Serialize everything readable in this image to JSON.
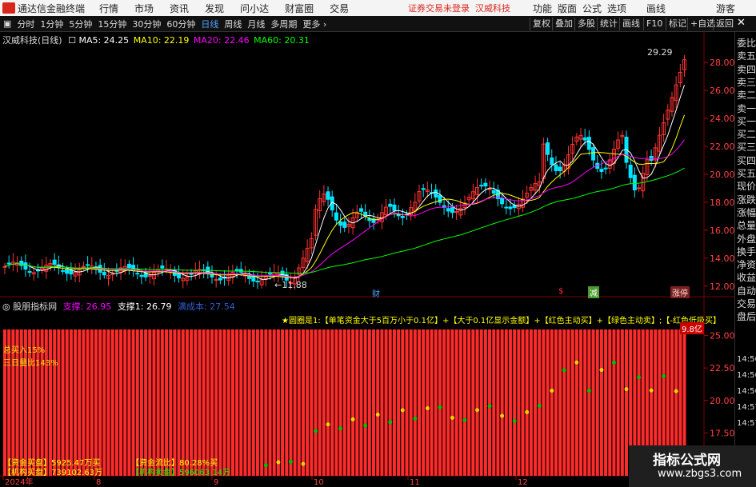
{
  "menubar": {
    "app_title": "通达信金融终端",
    "items": [
      "行情",
      "市场",
      "资讯",
      "发现",
      "问小达",
      "财富圈",
      "交易"
    ],
    "notice": "证券交易未登录",
    "stock_name": "汉威科技",
    "right_items": [
      "功能",
      "版面",
      "公式",
      "选项",
      "画线",
      "游客"
    ]
  },
  "toolbar": {
    "tabs": [
      "分时",
      "1分钟",
      "5分钟",
      "15分钟",
      "30分钟",
      "60分钟",
      "日线",
      "周线",
      "月线",
      "多周期",
      "更多"
    ],
    "active_tab": "日线",
    "right_buttons": [
      "复权",
      "叠加",
      "多股",
      "统计",
      "画线",
      "F10",
      "标记",
      "+自选",
      "返回"
    ]
  },
  "main_legend": {
    "title": "汉威科技(日线)",
    "ma5": "MA5: 24.25",
    "ma10": "MA10: 22.19",
    "ma20": "MA20: 22.46",
    "ma60": "MA60: 20.31"
  },
  "main_annotations": {
    "high_price": "29.29",
    "low_price": "11.88",
    "event_cai": "财",
    "event_s": "$",
    "event_jian": "减",
    "event_zhangting": "涨停"
  },
  "price_axis": {
    "ticks": [
      "28.00",
      "26.00",
      "24.00",
      "22.00",
      "20.00",
      "18.00",
      "16.00",
      "14.00",
      "12.00"
    ]
  },
  "indicator": {
    "name": "股朋指标网",
    "support": "支撑: 26.95",
    "support1": "支撑1: 26.79",
    "dim_label": "满成本: 27.54",
    "formula_text": "★圆圈是1:【单笔资金大于5百万小于0.1亿】+【大于0.1亿显示金额】+【红色主动买】+【绿色主动卖】;【-红色低吸买】",
    "total_buy": "总买入15%",
    "three_day": "三日量比143%",
    "fund_buy": "【资金买盘】5925.47万买",
    "inst_buy": "【机构买盘】739102.63万",
    "fund_ratio": "【资金流比】80.28%买",
    "inst_sell": "【机构卖盘】596063.14万",
    "badge_max": "9.8亿"
  },
  "indicator_axis": {
    "ticks": [
      "25.00",
      "22.50",
      "20.00",
      "17.50",
      "15.00"
    ]
  },
  "date_axis": {
    "labels": [
      "2024年",
      "8",
      "9",
      "10",
      "11",
      "12"
    ]
  },
  "side_panel": {
    "items": [
      "委比",
      "卖五",
      "卖四",
      "卖三",
      "卖二",
      "卖一",
      "买一",
      "买二",
      "买三",
      "买四",
      "买五",
      "现价",
      "涨跌",
      "涨幅",
      "总量",
      "外盘",
      "换手",
      "净资",
      "收益",
      "自动",
      "交易",
      "盘后"
    ],
    "times": [
      "14:56",
      "14:56",
      "14:56",
      "14:57",
      "14:57"
    ]
  },
  "watermark": {
    "line1": "指标公式网",
    "line2": "www.zbgs3.com"
  },
  "colors": {
    "up": "#ff3232",
    "down": "#00e4ff",
    "ma5": "#ffffff",
    "ma10": "#ffff00",
    "ma20": "#ff00ff",
    "ma60": "#00ff00",
    "bar": "#ff2a2a"
  }
}
